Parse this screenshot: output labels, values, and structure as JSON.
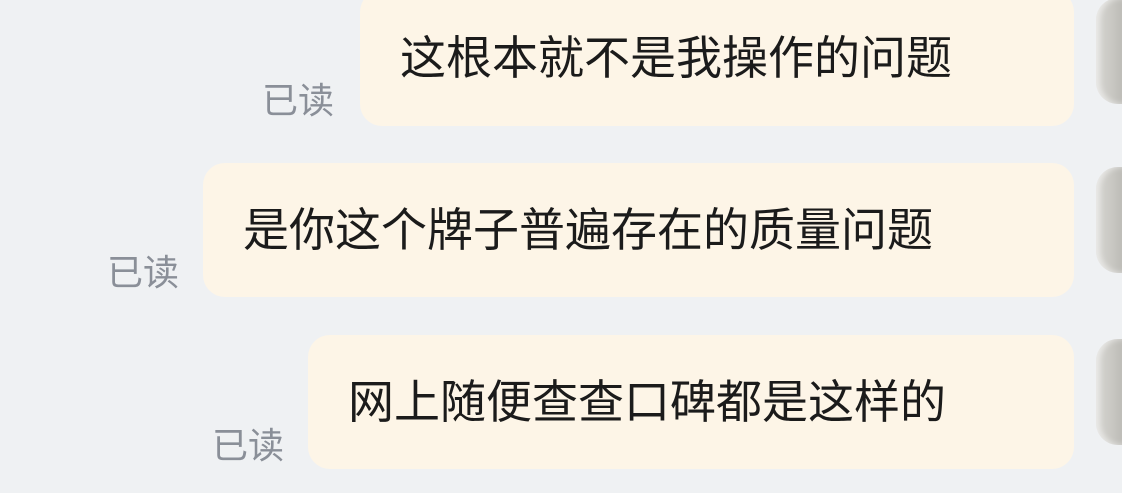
{
  "messages": [
    {
      "text": "这根本就不是我操作的问题",
      "status": "已读"
    },
    {
      "text": "是你这个牌子普遍存在的质量问题",
      "status": "已读"
    },
    {
      "text": "网上随便查查口碑都是这样的",
      "status": "已读"
    }
  ],
  "colors": {
    "background": "#eff1f3",
    "bubble": "#fdf5e7",
    "text": "#1b1b1b",
    "read_receipt": "#8a8f98"
  }
}
